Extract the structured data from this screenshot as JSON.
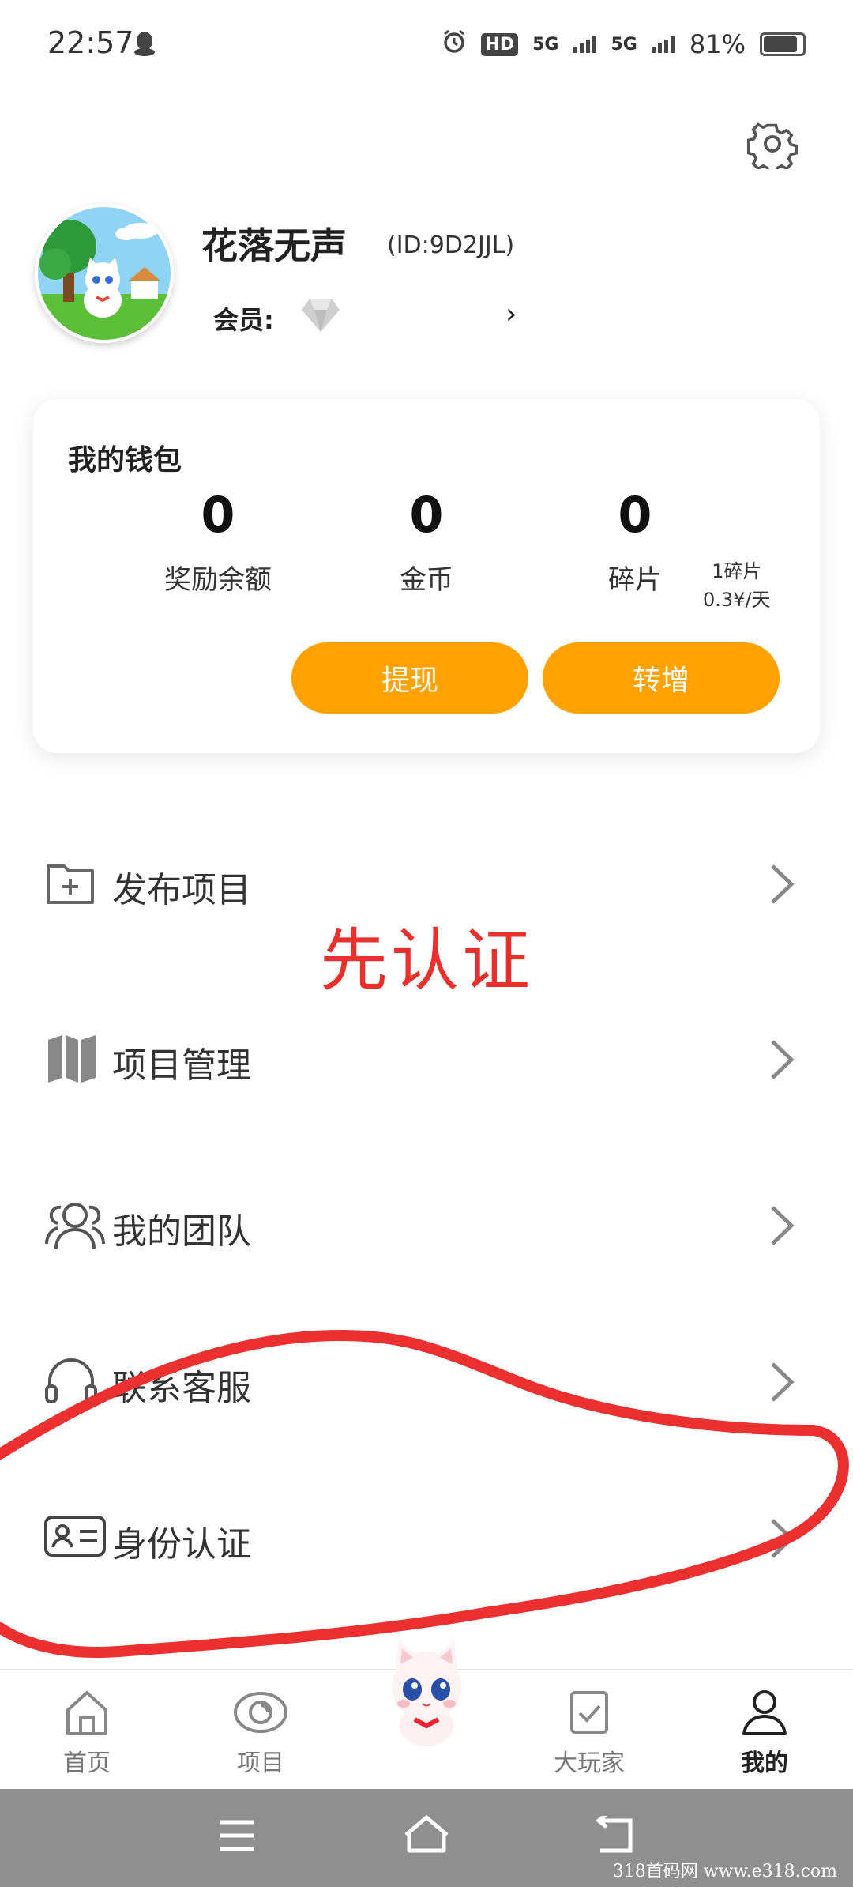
{
  "status_bar": {
    "time": "22:57",
    "network1": "5G",
    "network2": "5G",
    "battery": "81%"
  },
  "profile": {
    "nickname": "花落无声",
    "user_id": "(ID:9D2JJL)",
    "member_label": "会员:",
    "member_chevron": "›"
  },
  "wallet": {
    "title": "我的钱包",
    "stats": [
      {
        "value": "0",
        "label": "奖励余额"
      },
      {
        "value": "0",
        "label": "金币"
      },
      {
        "value": "0",
        "label": "碎片"
      }
    ],
    "shard_note_line1": "1碎片",
    "shard_note_line2": "0.3¥/天",
    "withdraw_label": "提现",
    "transfer_label": "转增"
  },
  "menu": [
    {
      "label": "发布项目",
      "icon": "folder-plus-icon"
    },
    {
      "label": "项目管理",
      "icon": "map-icon"
    },
    {
      "label": "我的团队",
      "icon": "team-icon"
    },
    {
      "label": "联系客服",
      "icon": "headset-icon"
    },
    {
      "label": "身份认证",
      "icon": "id-card-icon"
    }
  ],
  "annotation": {
    "text": "先认证",
    "color": "#e8302c"
  },
  "bottom_nav": [
    {
      "label": "首页",
      "icon": "home-icon"
    },
    {
      "label": "项目",
      "icon": "eye-icon"
    },
    {
      "label": "大玩家",
      "icon": "checkbox-icon"
    },
    {
      "label": "我的",
      "icon": "user-icon",
      "active": true
    }
  ],
  "watermark": "318首码网  www.e318.com",
  "colors": {
    "accent": "#ffa201",
    "annotation": "#e8302c"
  }
}
